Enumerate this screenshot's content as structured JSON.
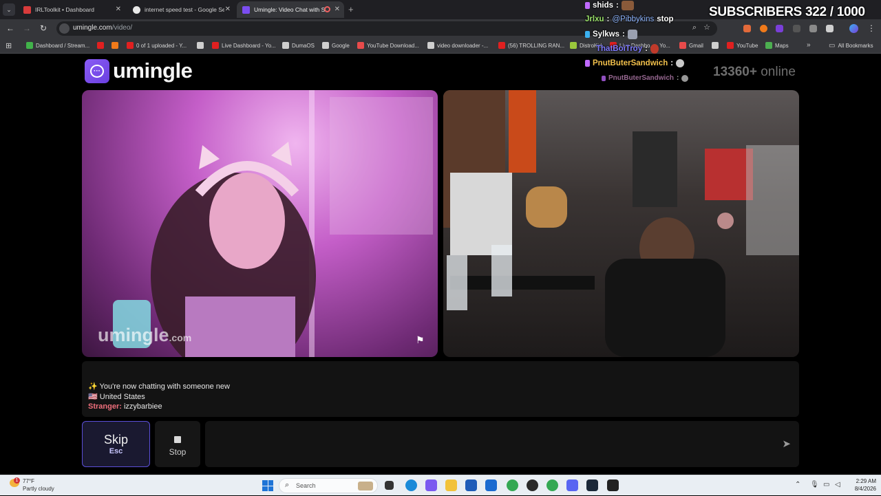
{
  "browser": {
    "tabs": [
      {
        "title": "IRLToolkit • Dashboard",
        "color": "#d83b3b"
      },
      {
        "title": "internet speed test - Google Se",
        "color": "#e8e8e8"
      },
      {
        "title": "Umingle: Video Chat with S",
        "color": "#7b4df0"
      }
    ],
    "url_host": "umingle.com",
    "url_path": "/video/",
    "bookmarks": [
      {
        "label": "Dashboard / Stream...",
        "color": "#41b24a"
      },
      {
        "label": "",
        "color": "#e02020"
      },
      {
        "label": "",
        "color": "#f07a1a"
      },
      {
        "label": "0 of 1 uploaded - Y...",
        "color": "#e02020"
      },
      {
        "label": "",
        "color": "#cfcfcf"
      },
      {
        "label": "Live Dashboard - Yo...",
        "color": "#e02020"
      },
      {
        "label": "DumaOS",
        "color": "#cfcfcf"
      },
      {
        "label": "Google",
        "color": "#cfcfcf"
      },
      {
        "label": "YouTube Download...",
        "color": "#e84b4b"
      },
      {
        "label": "video downloader -...",
        "color": "#cfcfcf"
      },
      {
        "label": "(56) TROLLING RAN...",
        "color": "#e02020"
      },
      {
        "label": "DistroKid",
        "color": "#9ac83c"
      },
      {
        "label": "Live Dashbo... - Yo...",
        "color": "#e02020"
      },
      {
        "label": "Gmail",
        "color": "#e84b4b"
      },
      {
        "label": "",
        "color": "#cfcfcf"
      },
      {
        "label": "YouTube",
        "color": "#e02020"
      },
      {
        "label": "Maps",
        "color": "#4caf50"
      }
    ],
    "all_bookmarks": "All Bookmarks"
  },
  "page": {
    "logo_text": "umingle",
    "online_count": "13360+",
    "online_label": "online",
    "watermark_main": "umingle",
    "watermark_tld": ".com",
    "chat": {
      "line1": "✨ You're now chatting with someone new",
      "line2": "🇺🇸 United States",
      "stranger_label": "Stranger:",
      "stranger_name": "izzybarbiee"
    },
    "skip_label": "Skip",
    "skip_key": "Esc",
    "stop_label": "Stop"
  },
  "overlay": {
    "subscribers": "SUBSCRIBERS 322 / 1000",
    "chat": [
      {
        "user": "shids",
        "sep": ":",
        "text": "",
        "user_color": "#ffffff",
        "badge": "#c06aff"
      },
      {
        "user": "Jrlxu",
        "sep": ":",
        "text": "@Pibbykins stop",
        "user_color": "#9be36b",
        "badge": "",
        "mention": "@Pibbykins",
        "rest": "stop"
      },
      {
        "user": "Sylkws",
        "sep": ":",
        "text": "",
        "user_color": "#ffffff",
        "badge": "#3ab0f0"
      },
      {
        "user": "ThatBoiTroy",
        "sep": ":",
        "text": "",
        "user_color": "#7f7bff",
        "badge": ""
      },
      {
        "user": "PnutButerSandwich",
        "sep": ":",
        "text": "",
        "user_color": "#f2c04b",
        "badge": "#c06aff"
      },
      {
        "user": "PnutButerSandwich",
        "sep": ":",
        "text": "",
        "user_color": "#c88ac0",
        "badge": "#c06aff"
      }
    ]
  },
  "taskbar": {
    "temperature": "77°F",
    "condition": "Partly cloudy",
    "notification_count": "1",
    "search_placeholder": "Search",
    "time": "2:29 AM",
    "date": "8/4/2026"
  }
}
